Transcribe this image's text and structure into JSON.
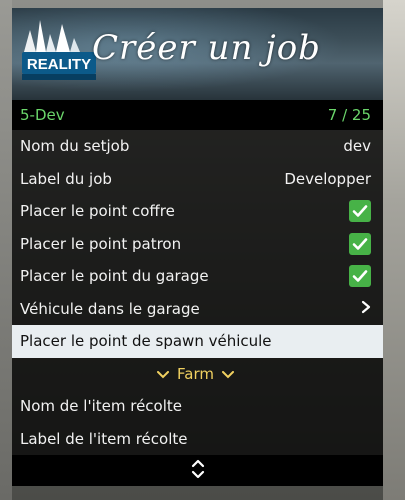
{
  "banner": {
    "title": "Créer un job",
    "logo_text": "REALITY"
  },
  "subheader": {
    "left": "5-Dev",
    "right": "7 / 25"
  },
  "items": [
    {
      "label": "Nom du setjob",
      "value": "dev"
    },
    {
      "label": "Label du job",
      "value": "Developper"
    },
    {
      "label": "Placer le point coffre",
      "checked": true
    },
    {
      "label": "Placer le point patron",
      "checked": true
    },
    {
      "label": "Placer le point du garage",
      "checked": true
    },
    {
      "label": "Véhicule dans le garage",
      "icon": "chevron-right-icon"
    },
    {
      "label": "Placer le point de spawn véhicule",
      "selected": true
    },
    {
      "label": "Farm",
      "separator": true
    },
    {
      "label": "Nom de l'item récolte"
    },
    {
      "label": "Label de l'item récolte"
    }
  ],
  "colors": {
    "subheader_text": "#6bd66b",
    "checkbox": "#47b247",
    "separator_text": "#f0d060",
    "selected_bg": "#e9eef1"
  }
}
